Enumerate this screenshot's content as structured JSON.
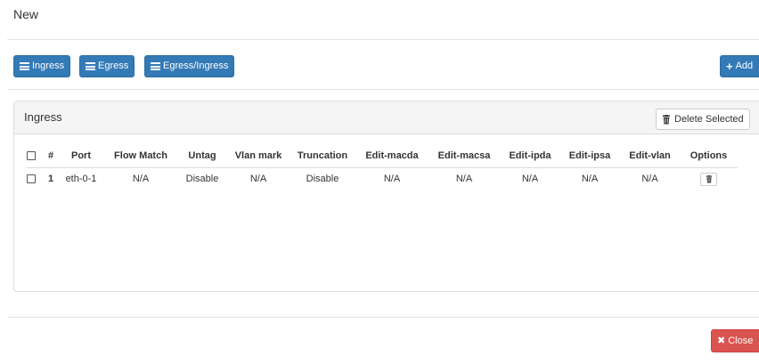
{
  "modal": {
    "title": "New"
  },
  "toolbar": {
    "ingress_label": "Ingress",
    "egress_label": "Egress",
    "egress_ingress_label": "Egress/Ingress",
    "add_label": "Add"
  },
  "panel": {
    "title": "Ingress",
    "delete_selected_label": "Delete Selected"
  },
  "table": {
    "columns": {
      "num": "#",
      "port": "Port",
      "flow_match": "Flow Match",
      "untag": "Untag",
      "vlan_mark": "Vlan mark",
      "truncation": "Truncation",
      "edit_macda": "Edit-macda",
      "edit_macsa": "Edit-macsa",
      "edit_ipda": "Edit-ipda",
      "edit_ipsa": "Edit-ipsa",
      "edit_vlan": "Edit-vlan",
      "options": "Options"
    },
    "rows": [
      {
        "num": "1",
        "port": "eth-0-1",
        "flow_match": "N/A",
        "untag": "Disable",
        "vlan_mark": "N/A",
        "truncation": "Disable",
        "edit_macda": "N/A",
        "edit_macsa": "N/A",
        "edit_ipda": "N/A",
        "edit_ipsa": "N/A",
        "edit_vlan": "N/A"
      }
    ]
  },
  "footer": {
    "close_label": "Close"
  },
  "colors": {
    "primary": "#337ab7",
    "danger": "#d9534f",
    "panel_heading_bg": "#f5f5f5",
    "border": "#dddddd"
  },
  "icons": {
    "list": "list-icon",
    "plus": "plus-icon",
    "trash": "trash-icon",
    "close": "close-icon"
  }
}
